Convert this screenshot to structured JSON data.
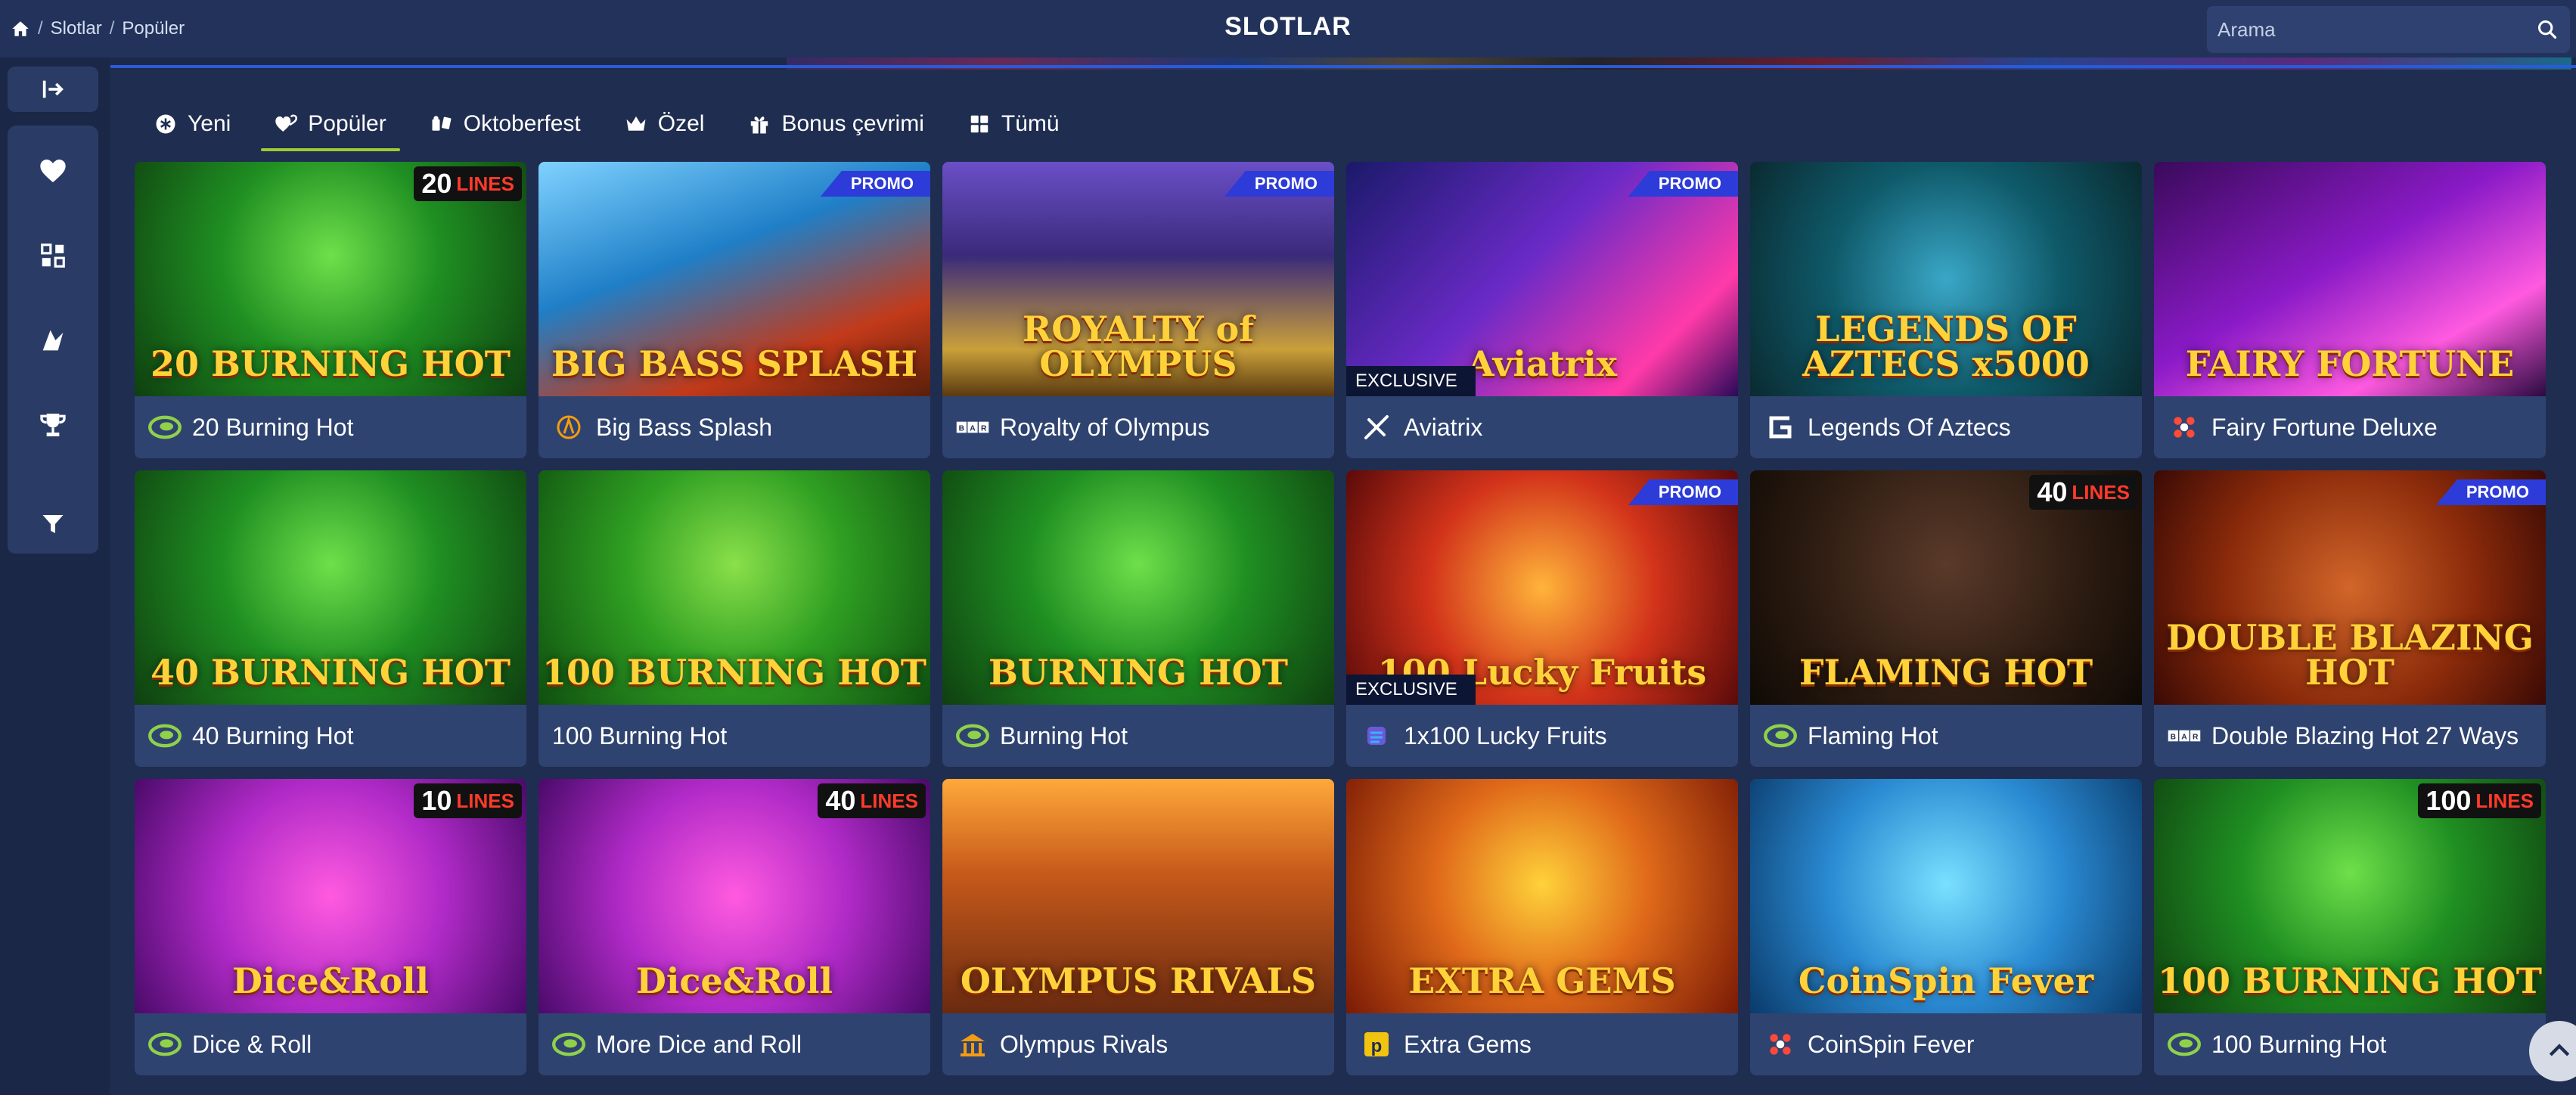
{
  "breadcrumb": {
    "items": [
      "Slotlar",
      "Popüler"
    ],
    "separator": "/"
  },
  "page_title": "SLOTLAR",
  "search": {
    "placeholder": "Arama",
    "value": ""
  },
  "tabs": [
    {
      "label": "Yeni",
      "icon": "asterisk-icon",
      "active": false
    },
    {
      "label": "Popüler",
      "icon": "hearts-icon",
      "active": true
    },
    {
      "label": "Oktoberfest",
      "icon": "beer-mugs-icon",
      "active": false
    },
    {
      "label": "Özel",
      "icon": "crown-icon",
      "active": false
    },
    {
      "label": "Bonus çevrimi",
      "icon": "gift-icon",
      "active": false
    },
    {
      "label": "Tümü",
      "icon": "grid-icon",
      "active": false
    }
  ],
  "games": [
    {
      "name": "20 Burning Hot",
      "art": "20 BURNING HOT",
      "lines_num": "20",
      "lines": "LINES",
      "promo": "",
      "exclusive": "",
      "provider_icon": "egt-icon"
    },
    {
      "name": "Big Bass Splash",
      "art": "BIG BASS SPLASH",
      "lines_num": "",
      "lines": "",
      "promo": "PROMO",
      "exclusive": "",
      "provider_icon": "pragmatic-icon"
    },
    {
      "name": "Royalty of Olympus",
      "art": "ROYALTY of OLYMPUS",
      "lines_num": "",
      "lines": "",
      "promo": "PROMO",
      "exclusive": "",
      "provider_icon": "barbarabang-icon"
    },
    {
      "name": "Aviatrix",
      "art": "Aviatrix",
      "lines_num": "",
      "lines": "",
      "promo": "PROMO",
      "exclusive": "EXCLUSIVE",
      "provider_icon": "aviatrix-icon"
    },
    {
      "name": "Legends Of Aztecs",
      "art": "LEGENDS OF AZTECS x5000",
      "lines_num": "",
      "lines": "",
      "promo": "",
      "exclusive": "",
      "provider_icon": "g-icon"
    },
    {
      "name": "Fairy Fortune Deluxe",
      "art": "FAIRY FORTUNE",
      "lines_num": "",
      "lines": "",
      "promo": "",
      "exclusive": "",
      "provider_icon": "dots-icon"
    },
    {
      "name": "40 Burning Hot",
      "art": "40 BURNING HOT",
      "lines_num": "",
      "lines": "",
      "promo": "",
      "exclusive": "",
      "provider_icon": "egt-icon"
    },
    {
      "name": "100 Burning Hot",
      "art": "100 BURNING HOT",
      "lines_num": "",
      "lines": "",
      "promo": "",
      "exclusive": "",
      "provider_icon": ""
    },
    {
      "name": "Burning Hot",
      "art": "BURNING HOT",
      "lines_num": "",
      "lines": "",
      "promo": "",
      "exclusive": "",
      "provider_icon": "egt-icon"
    },
    {
      "name": "1x100 Lucky Fruits",
      "art": "100 Lucky Fruits",
      "lines_num": "",
      "lines": "",
      "promo": "PROMO",
      "exclusive": "EXCLUSIVE",
      "provider_icon": "stack-icon"
    },
    {
      "name": "Flaming Hot",
      "art": "FLAMING HOT",
      "lines_num": "40",
      "lines": "LINES",
      "promo": "",
      "exclusive": "",
      "provider_icon": "egt-icon"
    },
    {
      "name": "Double Blazing Hot 27 Ways",
      "art": "DOUBLE BLAZING HOT",
      "lines_num": "",
      "lines": "",
      "promo": "PROMO",
      "exclusive": "",
      "provider_icon": "barbarabang-icon"
    },
    {
      "name": "Dice & Roll",
      "art": "Dice&Roll",
      "lines_num": "10",
      "lines": "LINES",
      "promo": "",
      "exclusive": "",
      "provider_icon": "egt-icon"
    },
    {
      "name": "More Dice and Roll",
      "art": "Dice&Roll",
      "lines_num": "40",
      "lines": "LINES",
      "promo": "",
      "exclusive": "",
      "provider_icon": "egt-icon"
    },
    {
      "name": "Olympus Rivals",
      "art": "OLYMPUS RIVALS",
      "lines_num": "",
      "lines": "",
      "promo": "",
      "exclusive": "",
      "provider_icon": "temple-icon"
    },
    {
      "name": "Extra Gems",
      "art": "EXTRA GEMS",
      "lines_num": "",
      "lines": "",
      "promo": "",
      "exclusive": "",
      "provider_icon": "p-icon"
    },
    {
      "name": "CoinSpin Fever",
      "art": "CoinSpin Fever",
      "lines_num": "",
      "lines": "",
      "promo": "",
      "exclusive": "",
      "provider_icon": "dots-icon"
    },
    {
      "name": "100 Burning Hot",
      "art": "100 BURNING HOT",
      "lines_num": "100",
      "lines": "LINES",
      "promo": "",
      "exclusive": "",
      "provider_icon": "egt-icon"
    }
  ],
  "colors": {
    "background": "#1c2a4a",
    "card": "#2f4370",
    "accent": "#9acd32",
    "promo": "#2d3bd8"
  }
}
